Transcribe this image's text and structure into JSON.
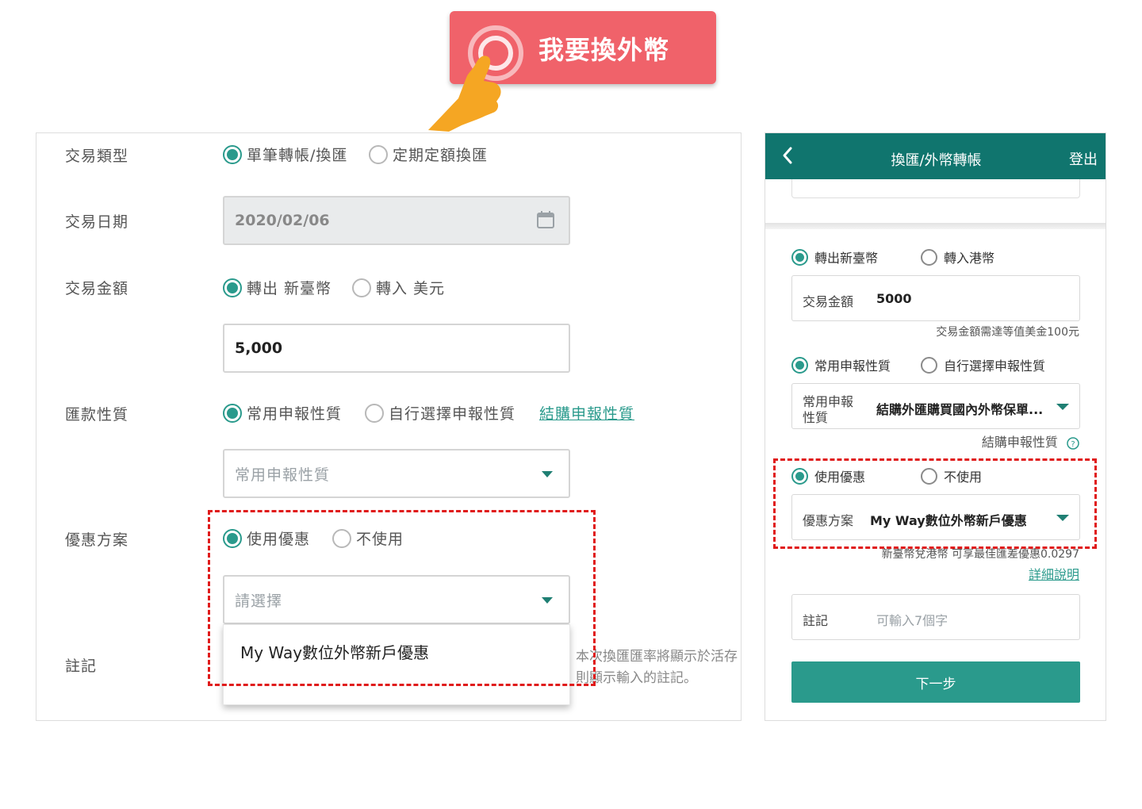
{
  "callout": {
    "label": "我要換外幣",
    "colors": {
      "background": "#f0626a",
      "hand": "#f5a623"
    }
  },
  "desktop": {
    "transaction_type": {
      "label": "交易類型",
      "options": [
        "單筆轉帳/換匯",
        "定期定額換匯"
      ],
      "selected": 0
    },
    "transaction_date": {
      "label": "交易日期",
      "value": "2020/02/06",
      "icon": "calendar-icon"
    },
    "transaction_amount": {
      "label": "交易金額",
      "options": [
        "轉出 新臺幣",
        "轉入 美元"
      ],
      "selected": 0,
      "value": "5,000"
    },
    "remittance_nature": {
      "label": "匯款性質",
      "options": [
        "常用申報性質",
        "自行選擇申報性質"
      ],
      "selected": 0,
      "link": "結購申報性質",
      "select_placeholder": "常用申報性質"
    },
    "promotion": {
      "label": "優惠方案",
      "options": [
        "使用優惠",
        "不使用"
      ],
      "selected": 0,
      "select_placeholder": "請選擇",
      "dropdown_option": "My Way數位外幣新戶優惠"
    },
    "memo": {
      "label": "註記",
      "note_line1": "本次換匯匯率將顯示於活存",
      "note_line2": "則顯示輸入的註記。"
    }
  },
  "mobile": {
    "header": {
      "title": "換匯/外幣轉帳",
      "logout": "登出"
    },
    "direction": {
      "options": [
        "轉出新臺幣",
        "轉入港幣"
      ],
      "selected": 0
    },
    "amount": {
      "label": "交易金額",
      "value": "5000",
      "hint": "交易金額需達等值美金100元"
    },
    "nature": {
      "options": [
        "常用申報性質",
        "自行選擇申報性質"
      ],
      "selected": 0,
      "field_label_line1": "常用申報",
      "field_label_line2": "性質",
      "value": "結購外匯購買國內外幣保單...",
      "link": "結購申報性質"
    },
    "promotion": {
      "options": [
        "使用優惠",
        "不使用"
      ],
      "selected": 0,
      "field_label": "優惠方案",
      "value": "My Way數位外幣新戶優惠",
      "hint": "新臺幣兌港幣 可享最佳匯差優惠0.0297",
      "details_link": "詳細說明"
    },
    "memo": {
      "label": "註記",
      "placeholder": "可輸入7個字"
    },
    "next_button": "下一步"
  },
  "colors": {
    "accent": "#2a9a8c",
    "header": "#10756e",
    "highlight_border": "#e01b1b"
  }
}
